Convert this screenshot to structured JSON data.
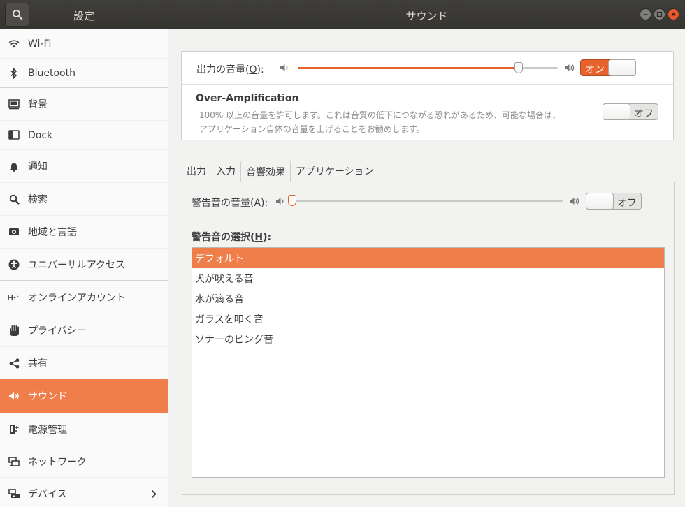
{
  "header": {
    "left_title": "設定",
    "title": "サウンド"
  },
  "sidebar": {
    "items": [
      {
        "label": "Wi-Fi",
        "icon": "wifi-icon"
      },
      {
        "label": "Bluetooth",
        "icon": "bluetooth-icon"
      },
      {
        "label": "背景",
        "icon": "background-icon"
      },
      {
        "label": "Dock",
        "icon": "dock-icon"
      },
      {
        "label": "通知",
        "icon": "bell-icon"
      },
      {
        "label": "検索",
        "icon": "search-icon"
      },
      {
        "label": "地域と言語",
        "icon": "region-icon"
      },
      {
        "label": "ユニバーサルアクセス",
        "icon": "accessibility-icon"
      },
      {
        "label": "オンラインアカウント",
        "icon": "online-accounts-icon"
      },
      {
        "label": "プライバシー",
        "icon": "privacy-hand-icon"
      },
      {
        "label": "共有",
        "icon": "share-icon"
      },
      {
        "label": "サウンド",
        "icon": "speaker-icon"
      },
      {
        "label": "電源管理",
        "icon": "power-plug-icon"
      },
      {
        "label": "ネットワーク",
        "icon": "network-icon"
      },
      {
        "label": "デバイス",
        "icon": "devices-icon"
      }
    ],
    "active": "サウンド"
  },
  "output": {
    "label_prefix": "出力の音量(",
    "mnemonic": "O",
    "label_suffix": "):",
    "volume": 0.85,
    "switch_label": "オン",
    "switch_on": true
  },
  "over_amp": {
    "title": "Over-Amplification",
    "desc_line1": "100% 以上の音量を許可します。これは音質の低下につながる恐れがあるため、可能な場合は、",
    "desc_line2": "アプリケーション自体の音量を上げることをお勧めします。",
    "switch_label": "オフ",
    "switch_on": false
  },
  "tabs": [
    {
      "label": "出力"
    },
    {
      "label": "入力"
    },
    {
      "label": "音響効果"
    },
    {
      "label": "アプリケーション"
    }
  ],
  "active_tab": "音響効果",
  "alert": {
    "label_prefix": "警告音の音量(",
    "mnemonic": "A",
    "label_suffix": "):",
    "volume": 0.0,
    "switch_label": "オフ",
    "switch_on": false
  },
  "choose": {
    "label_prefix": "警告音の選択(",
    "mnemonic": "H",
    "label_suffix": "):"
  },
  "sounds": [
    {
      "label": "デフォルト"
    },
    {
      "label": "犬が吠える音"
    },
    {
      "label": "水が滴る音"
    },
    {
      "label": "ガラスを叩く音"
    },
    {
      "label": "ソナーのピング音"
    }
  ],
  "selected_sound": "デフォルト",
  "colors": {
    "accent": "#f07e4b",
    "switch_on": "#e9622c",
    "header": "#3a3935"
  }
}
